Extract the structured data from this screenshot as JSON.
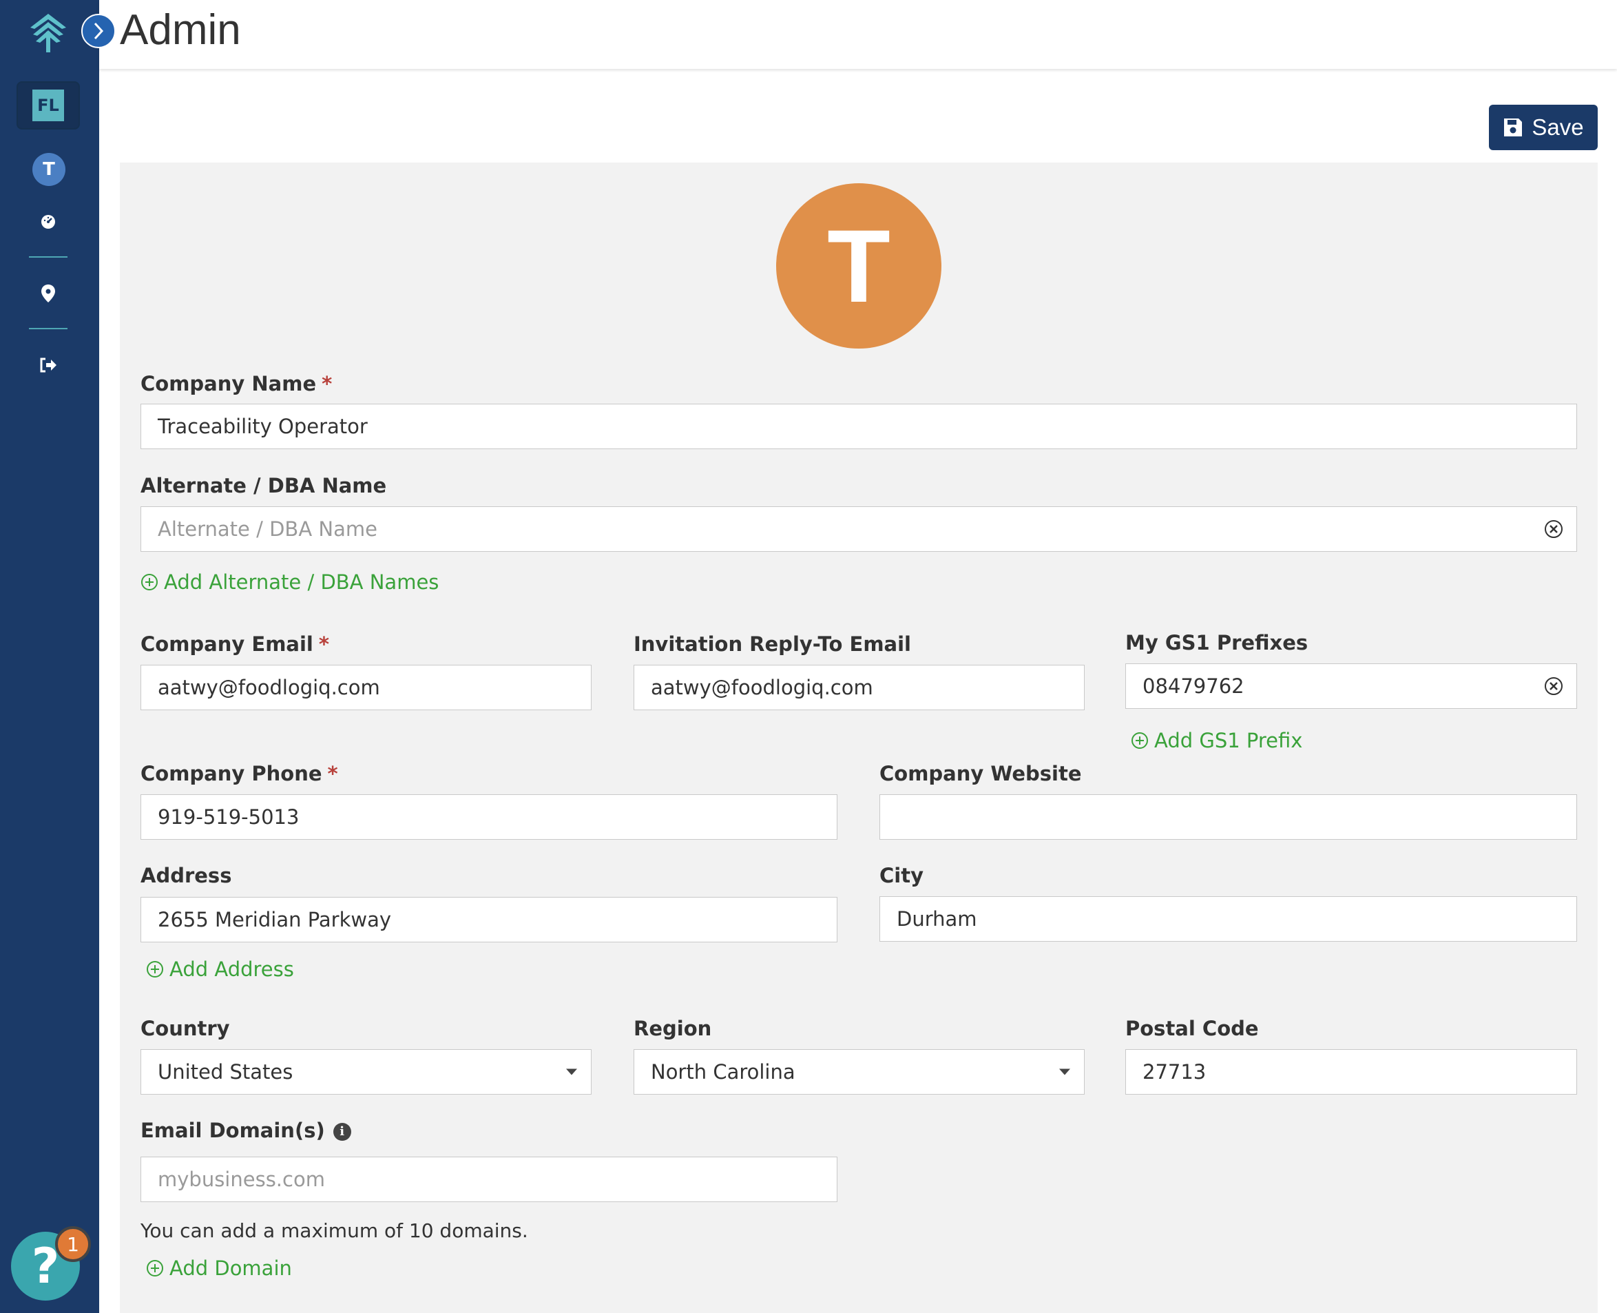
{
  "header": {
    "title": "Admin"
  },
  "sidebar": {
    "org_badge": "FL",
    "user_initial": "T"
  },
  "toolbar": {
    "save_label": "Save"
  },
  "profile": {
    "avatar_initial": "T",
    "avatar_color": "#e0904a"
  },
  "form": {
    "company_name": {
      "label": "Company Name",
      "required": "*",
      "value": "Traceability Operator"
    },
    "alt_name": {
      "label": "Alternate / DBA Name",
      "placeholder": "Alternate / DBA Name",
      "add_label": "Add Alternate / DBA Names"
    },
    "company_email": {
      "label": "Company Email",
      "required": "*",
      "value": "aatwy@foodlogiq.com"
    },
    "reply_email": {
      "label": "Invitation Reply-To Email",
      "value": "aatwy@foodlogiq.com"
    },
    "gs1": {
      "label": "My GS1 Prefixes",
      "value": "08479762",
      "add_label": "Add GS1 Prefix"
    },
    "company_phone": {
      "label": "Company Phone",
      "required": "*",
      "value": "919-519-5013"
    },
    "company_website": {
      "label": "Company Website",
      "value": ""
    },
    "address": {
      "label": "Address",
      "value": "2655 Meridian Parkway",
      "add_label": "Add Address"
    },
    "city": {
      "label": "City",
      "value": "Durham"
    },
    "country": {
      "label": "Country",
      "value": "United States"
    },
    "region": {
      "label": "Region",
      "value": "North Carolina"
    },
    "postal_code": {
      "label": "Postal Code",
      "value": "27713"
    },
    "email_domains": {
      "label": "Email Domain(s)",
      "placeholder": "mybusiness.com",
      "help": "You can add a maximum of 10 domains.",
      "add_label": "Add Domain"
    }
  },
  "help_widget": {
    "glyph": "?",
    "badge_count": "1"
  },
  "colors": {
    "sidebar": "#1b3a68",
    "accent_green": "#3aa23a",
    "required": "#b8413b",
    "help": "#3aa6ae"
  }
}
